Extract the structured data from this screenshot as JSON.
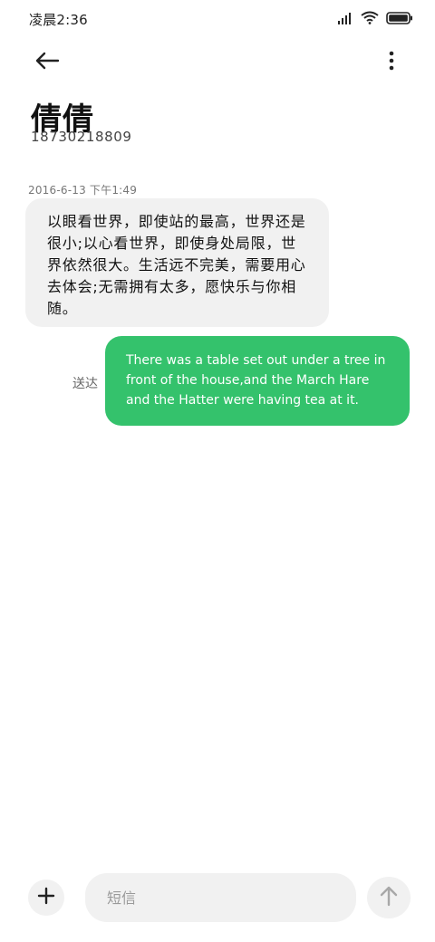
{
  "status_bar": {
    "time": "凌晨2:36",
    "icons": [
      "signal-icon",
      "wifi-icon",
      "battery-icon"
    ]
  },
  "header": {
    "back_icon": "back-arrow-icon",
    "more_icon": "more-vertical-icon",
    "contact_name": "倩倩",
    "contact_number": "18730218809"
  },
  "conversation": {
    "timestamp": "2016-6-13 下午1:49",
    "received_message": "以眼看世界，即使站的最高，世界还是很小;以心看世界，即使身处局限，世界依然很大。生活远不完美，需要用心去体会;无需拥有太多，愿快乐与你相随。",
    "sent_status": "送达",
    "sent_message": "There was a table set out under a tree in front of the house,and the March Hare and the Hatter were having tea at it."
  },
  "composer": {
    "add_icon": "plus-icon",
    "input_value": "",
    "input_placeholder": "短信",
    "send_icon": "send-arrow-up-icon"
  },
  "colors": {
    "sent_bubble": "#34c26c",
    "received_bubble": "#f1f1f1",
    "background": "#ffffff"
  }
}
